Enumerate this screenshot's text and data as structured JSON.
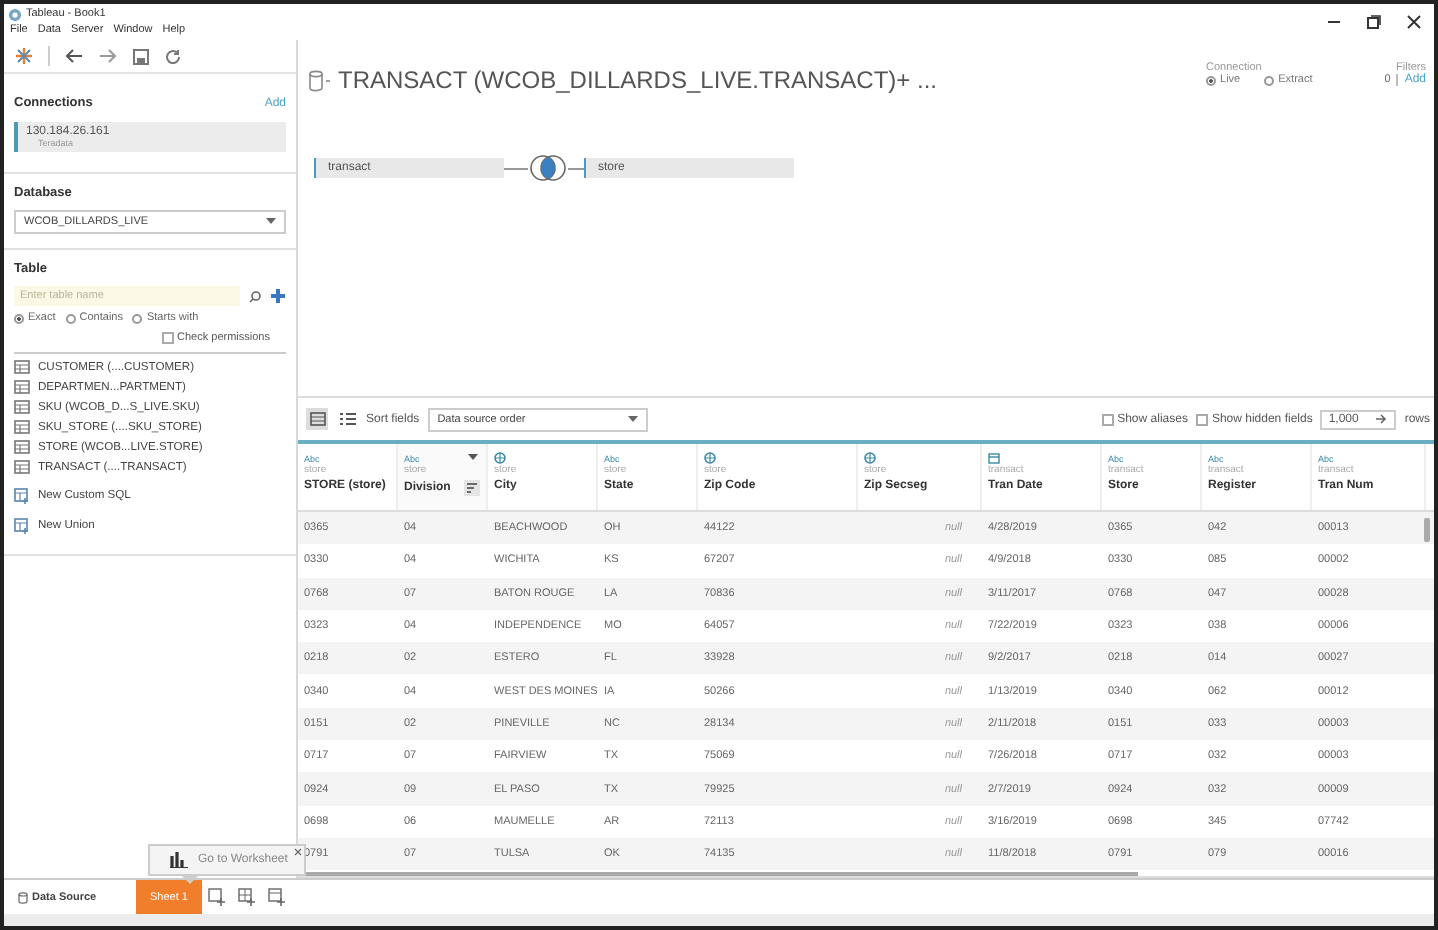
{
  "window": {
    "title": "Tableau - Book1"
  },
  "menu": [
    "File",
    "Data",
    "Server",
    "Window",
    "Help"
  ],
  "sidebar": {
    "connections": {
      "title": "Connections",
      "add": "Add",
      "items": [
        {
          "name": "130.184.26.161",
          "type": "Teradata"
        }
      ]
    },
    "database": {
      "title": "Database",
      "value": "WCOB_DILLARDS_LIVE"
    },
    "table": {
      "title": "Table",
      "search": {
        "placeholder": "Enter table name"
      },
      "match_options": [
        {
          "label": "Exact",
          "selected": true
        },
        {
          "label": "Contains",
          "selected": false
        },
        {
          "label": "Starts with",
          "selected": false
        }
      ],
      "check_permissions": {
        "label": "Check permissions",
        "checked": false
      },
      "tables": [
        "CUSTOMER (....CUSTOMER)",
        "DEPARTMEN...PARTMENT)",
        "SKU (WCOB_D...S_LIVE.SKU)",
        "SKU_STORE (....SKU_STORE)",
        "STORE (WCOB...LIVE.STORE)",
        "TRANSACT (....TRANSACT)"
      ],
      "actions": [
        "New Custom SQL",
        "New Union"
      ]
    }
  },
  "datasource": {
    "title": "TRANSACT (WCOB_DILLARDS_LIVE.TRANSACT)+ ...",
    "connection": {
      "label": "Connection",
      "options": [
        {
          "label": "Live",
          "selected": true
        },
        {
          "label": "Extract",
          "selected": false
        }
      ]
    },
    "filters": {
      "label": "Filters",
      "count": "0",
      "add": "Add"
    },
    "join": {
      "left": "transact",
      "right": "store"
    }
  },
  "grid_toolbar": {
    "views": [
      {
        "kind": "grid",
        "selected": true
      },
      {
        "kind": "list",
        "selected": false
      }
    ],
    "sort_label": "Sort fields",
    "sort_value": "Data source order",
    "show_aliases": {
      "label": "Show aliases",
      "checked": false
    },
    "show_hidden": {
      "label": "Show hidden fields",
      "checked": false
    },
    "row_count": "1,000",
    "rows_label": "rows"
  },
  "grid": {
    "columns": [
      {
        "kind": "string",
        "type_label": "Abc",
        "source": "store",
        "name": "STORE (store)",
        "hovered": false,
        "italic": false
      },
      {
        "kind": "string",
        "type_label": "Abc",
        "source": "store",
        "name": "Division",
        "hovered": true,
        "italic": false
      },
      {
        "kind": "geo",
        "source": "store",
        "name": "City",
        "hovered": false,
        "italic": false
      },
      {
        "kind": "string",
        "type_label": "Abc",
        "source": "store",
        "name": "State",
        "hovered": false,
        "italic": false
      },
      {
        "kind": "geo",
        "source": "store",
        "name": "Zip Code",
        "hovered": false,
        "italic": false
      },
      {
        "kind": "geo",
        "source": "store",
        "name": "Zip Secseg",
        "hovered": false,
        "italic": true
      },
      {
        "kind": "date",
        "source": "transact",
        "name": "Tran Date",
        "hovered": false,
        "italic": false
      },
      {
        "kind": "string",
        "type_label": "Abc",
        "source": "transact",
        "name": "Store",
        "hovered": false,
        "italic": false
      },
      {
        "kind": "string",
        "type_label": "Abc",
        "source": "transact",
        "name": "Register",
        "hovered": false,
        "italic": false
      },
      {
        "kind": "string",
        "type_label": "Abc",
        "source": "transact",
        "name": "Tran Num",
        "hovered": false,
        "italic": false
      }
    ],
    "rows": [
      [
        "0365",
        "04",
        "BEACHWOOD",
        "OH",
        "44122",
        "null",
        "4/28/2019",
        "0365",
        "042",
        "00013"
      ],
      [
        "0330",
        "04",
        "WICHITA",
        "KS",
        "67207",
        "null",
        "4/9/2018",
        "0330",
        "085",
        "00002"
      ],
      [
        "0768",
        "07",
        "BATON ROUGE",
        "LA",
        "70836",
        "null",
        "3/11/2017",
        "0768",
        "047",
        "00028"
      ],
      [
        "0323",
        "04",
        "INDEPENDENCE",
        "MO",
        "64057",
        "null",
        "7/22/2019",
        "0323",
        "038",
        "00006"
      ],
      [
        "0218",
        "02",
        "ESTERO",
        "FL",
        "33928",
        "null",
        "9/2/2017",
        "0218",
        "014",
        "00027"
      ],
      [
        "0340",
        "04",
        "WEST DES MOINES",
        "IA",
        "50266",
        "null",
        "1/13/2019",
        "0340",
        "062",
        "00012"
      ],
      [
        "0151",
        "02",
        "PINEVILLE",
        "NC",
        "28134",
        "null",
        "2/11/2018",
        "0151",
        "033",
        "00003"
      ],
      [
        "0717",
        "07",
        "FAIRVIEW",
        "TX",
        "75069",
        "null",
        "7/26/2018",
        "0717",
        "032",
        "00003"
      ],
      [
        "0924",
        "09",
        "EL PASO",
        "TX",
        "79925",
        "null",
        "2/7/2019",
        "0924",
        "032",
        "00009"
      ],
      [
        "0698",
        "06",
        "MAUMELLE",
        "AR",
        "72113",
        "null",
        "3/16/2019",
        "0698",
        "345",
        "07742"
      ],
      [
        "0791",
        "07",
        "TULSA",
        "OK",
        "74135",
        "null",
        "11/8/2018",
        "0791",
        "079",
        "00016"
      ]
    ]
  },
  "tabs": [
    {
      "label": "Data Source",
      "kind": "datasource",
      "selected": false
    },
    {
      "label": "Sheet 1",
      "kind": "sheet",
      "selected": true
    }
  ],
  "tooltip": {
    "text": "Go to Worksheet"
  }
}
